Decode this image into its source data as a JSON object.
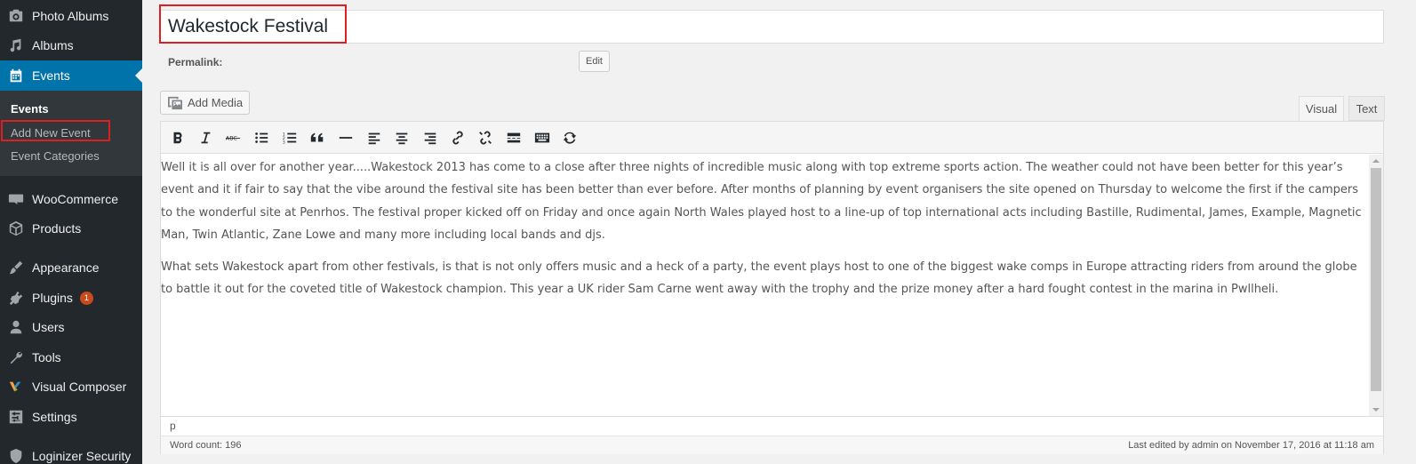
{
  "sidebar": {
    "items": [
      {
        "label": "Photo Albums",
        "icon": "camera-icon"
      },
      {
        "label": "Albums",
        "icon": "music-icon"
      },
      {
        "label": "Events",
        "icon": "calendar-icon"
      },
      {
        "label": "WooCommerce",
        "icon": "woo-icon"
      },
      {
        "label": "Products",
        "icon": "box-icon"
      },
      {
        "label": "Appearance",
        "icon": "brush-icon"
      },
      {
        "label": "Plugins",
        "icon": "plugin-icon",
        "badge": "1"
      },
      {
        "label": "Users",
        "icon": "user-icon"
      },
      {
        "label": "Tools",
        "icon": "wrench-icon"
      },
      {
        "label": "Visual Composer",
        "icon": "vc-icon"
      },
      {
        "label": "Settings",
        "icon": "settings-icon"
      },
      {
        "label": "Loginizer Security",
        "icon": "shield-icon"
      }
    ],
    "submenu": [
      "Events",
      "Add New Event",
      "Event Categories"
    ]
  },
  "post": {
    "title": "Wakestock Festival",
    "permalink_label": "Permalink:",
    "edit_label": "Edit"
  },
  "editor": {
    "add_media_label": "Add Media",
    "tabs": [
      "Visual",
      "Text"
    ],
    "toolbar_icons": [
      "bold-icon",
      "italic-icon",
      "strikethrough-icon",
      "bullet-list-icon",
      "numbered-list-icon",
      "blockquote-icon",
      "horizontal-line-icon",
      "align-left-icon",
      "align-center-icon",
      "align-right-icon",
      "link-icon",
      "unlink-icon",
      "read-more-icon",
      "toolbar-toggle-icon",
      "refresh-icon"
    ],
    "paragraphs": [
      "Well it is all over for another year.....Wakestock 2013 has come to a close after three nights of incredible music along with top extreme sports action. The weather could not have been better for this year’s event and it if fair to say that the vibe around the festival site has been better than ever before. After months of planning by event organisers the site opened on Thursday to welcome the first if the campers to the wonderful site at Penrhos. The festival proper kicked off on Friday and once again North Wales played host to a line-up of top international acts including Bastille, Rudimental, James, Example, Magnetic Man, Twin Atlantic, Zane Lowe and many more including local bands and djs.",
      "What sets Wakestock apart from other festivals, is that is not only offers music and a heck of a party, the event plays host to one of the biggest wake comps in Europe attracting riders from around the globe to battle it out for the coveted title of Wakestock champion. This year a UK rider Sam Carne went away with the trophy and the prize money after a hard fought contest in the marina in Pwllheli."
    ],
    "path": "p",
    "word_count": "Word count: 196",
    "last_edited": "Last edited by admin on November 17, 2016 at 11:18 am"
  },
  "colors": {
    "sidebar_bg": "#23282d",
    "active_bg": "#0073aa",
    "highlight": "#dd1f1f"
  }
}
